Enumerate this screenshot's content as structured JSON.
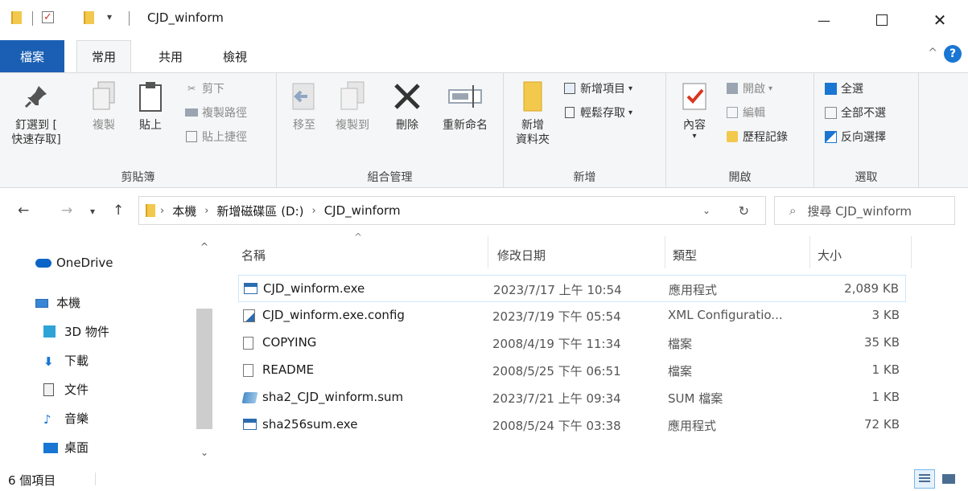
{
  "window": {
    "title": "CJD_winform"
  },
  "tabs": [
    {
      "label": "檔案"
    },
    {
      "label": "常用"
    },
    {
      "label": "共用"
    },
    {
      "label": "檢視"
    }
  ],
  "ribbon": {
    "clipboard": {
      "pin_label_1": "釘選到 [",
      "pin_label_2": "快速存取]",
      "copy_label": "複製",
      "paste_label": "貼上",
      "cut_label": "剪下",
      "copy_path_label": "複製路徑",
      "paste_shortcut_label": "貼上捷徑",
      "group_label": "剪貼簿"
    },
    "organize": {
      "move_label": "移至",
      "copy_to_label": "複製到",
      "delete_label": "刪除",
      "rename_label": "重新命名",
      "group_label": "組合管理"
    },
    "new": {
      "new_folder_1": "新增",
      "new_folder_2": "資料夾",
      "new_item_label": "新增項目",
      "easy_access_label": "輕鬆存取",
      "group_label": "新增"
    },
    "open": {
      "properties_label": "內容",
      "open_label": "開啟",
      "edit_label": "編輯",
      "history_label": "歷程記錄",
      "group_label": "開啟"
    },
    "select": {
      "select_all_label": "全選",
      "select_none_label": "全部不選",
      "invert_label": "反向選擇",
      "group_label": "選取"
    }
  },
  "address": {
    "crumbs": [
      "本機",
      "新增磁碟區 (D:)",
      "CJD_winform"
    ],
    "search_placeholder": "搜尋 CJD_winform"
  },
  "navpane": {
    "items": [
      {
        "label": "OneDrive",
        "icon": "onedrive-cloud-icon"
      },
      {
        "label": "本機",
        "icon": "this-pc-icon"
      },
      {
        "label": "3D 物件",
        "icon": "3d-objects-icon"
      },
      {
        "label": "下載",
        "icon": "download-icon"
      },
      {
        "label": "文件",
        "icon": "document-icon"
      },
      {
        "label": "音樂",
        "icon": "music-icon"
      },
      {
        "label": "桌面",
        "icon": "desktop-icon"
      }
    ]
  },
  "files": {
    "columns": {
      "name": "名稱",
      "date": "修改日期",
      "type": "類型",
      "size": "大小"
    },
    "rows": [
      {
        "name": "CJD_winform.exe",
        "date": "2023/7/17 上午 10:54",
        "type": "應用程式",
        "size": "2,089 KB",
        "icon": "exe-icon"
      },
      {
        "name": "CJD_winform.exe.config",
        "date": "2023/7/19 下午 05:54",
        "type": "XML Configuratio...",
        "size": "3 KB",
        "icon": "config-icon"
      },
      {
        "name": "COPYING",
        "date": "2008/4/19 下午 11:34",
        "type": "檔案",
        "size": "35 KB",
        "icon": "file-icon"
      },
      {
        "name": "README",
        "date": "2008/5/25 下午 06:51",
        "type": "檔案",
        "size": "1 KB",
        "icon": "file-icon"
      },
      {
        "name": "sha2_CJD_winform.sum",
        "date": "2023/7/21 上午 09:34",
        "type": "SUM 檔案",
        "size": "1 KB",
        "icon": "sum-icon"
      },
      {
        "name": "sha256sum.exe",
        "date": "2008/5/24 下午 03:38",
        "type": "應用程式",
        "size": "72 KB",
        "icon": "exe-icon"
      }
    ]
  },
  "status": {
    "item_count": "6 個項目"
  },
  "colors": {
    "accent": "#1a5fb4",
    "selection_border": "#cce8ff",
    "folder": "#f2c94c"
  }
}
